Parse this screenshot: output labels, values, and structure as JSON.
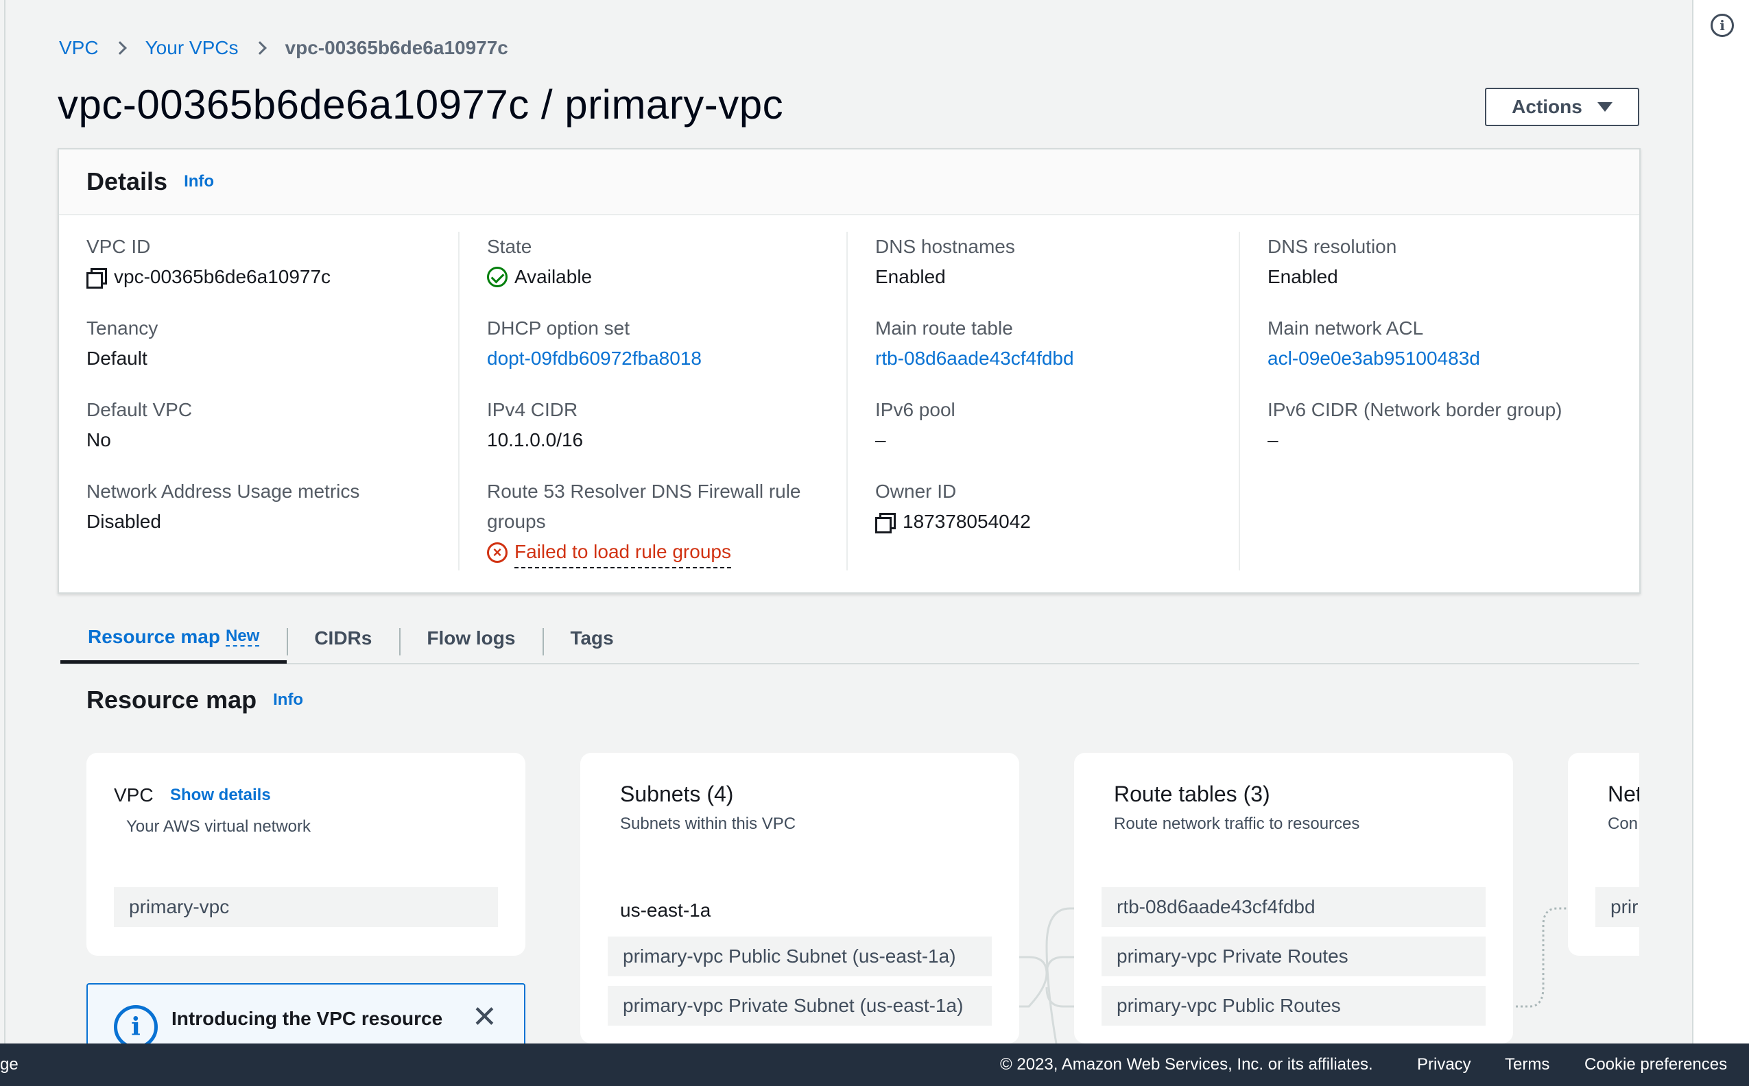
{
  "breadcrumb": {
    "items": [
      "VPC",
      "Your VPCs"
    ],
    "current": "vpc-00365b6de6a10977c"
  },
  "page_title": "vpc-00365b6de6a10977c / primary-vpc",
  "actions_label": "Actions",
  "details": {
    "title": "Details",
    "info": "Info",
    "vpc_id": {
      "label": "VPC ID",
      "value": "vpc-00365b6de6a10977c"
    },
    "tenancy": {
      "label": "Tenancy",
      "value": "Default"
    },
    "default_vpc": {
      "label": "Default VPC",
      "value": "No"
    },
    "nau_metrics": {
      "label": "Network Address Usage metrics",
      "value": "Disabled"
    },
    "state": {
      "label": "State",
      "value": "Available"
    },
    "dhcp": {
      "label": "DHCP option set",
      "value": "dopt-09fdb60972fba8018"
    },
    "ipv4_cidr": {
      "label": "IPv4 CIDR",
      "value": "10.1.0.0/16"
    },
    "route53": {
      "label_line1": "Route 53 Resolver DNS Firewall rule",
      "label_line2": "groups",
      "value": "Failed to load rule groups"
    },
    "dns_hostnames": {
      "label": "DNS hostnames",
      "value": "Enabled"
    },
    "main_route_table": {
      "label": "Main route table",
      "value": "rtb-08d6aade43cf4fdbd"
    },
    "ipv6_pool": {
      "label": "IPv6 pool",
      "value": "–"
    },
    "owner_id": {
      "label": "Owner ID",
      "value": "187378054042"
    },
    "dns_resolution": {
      "label": "DNS resolution",
      "value": "Enabled"
    },
    "main_acl": {
      "label": "Main network ACL",
      "value": "acl-09e0e3ab95100483d"
    },
    "ipv6_cidr": {
      "label": "IPv6 CIDR (Network border group)",
      "value": "–"
    }
  },
  "tabs": [
    {
      "label": "Resource map",
      "badge": "New"
    },
    {
      "label": "CIDRs"
    },
    {
      "label": "Flow logs"
    },
    {
      "label": "Tags"
    }
  ],
  "resource_map": {
    "title": "Resource map",
    "info": "Info",
    "vpc_card": {
      "title": "VPC",
      "show_details": "Show details",
      "subtitle": "Your AWS virtual network",
      "item": "primary-vpc"
    },
    "subnets_card": {
      "title": "Subnets (4)",
      "subtitle": "Subnets within this VPC",
      "az": "us-east-1a",
      "items": [
        "primary-vpc Public Subnet (us-east-1a)",
        "primary-vpc Private Subnet (us-east-1a)"
      ]
    },
    "routes_card": {
      "title": "Route tables (3)",
      "subtitle": "Route network traffic to resources",
      "items": [
        "rtb-08d6aade43cf4fdbd",
        "primary-vpc Private Routes",
        "primary-vpc Public Routes"
      ]
    },
    "network_card": {
      "title": "Net",
      "subtitle": "Con",
      "item": "prir"
    }
  },
  "intro_banner": {
    "title": "Introducing the VPC resource map"
  },
  "footer": {
    "left": "ge",
    "copyright": "© 2023, Amazon Web Services, Inc. or its affiliates.",
    "privacy": "Privacy",
    "terms": "Terms",
    "cookies": "Cookie preferences"
  }
}
